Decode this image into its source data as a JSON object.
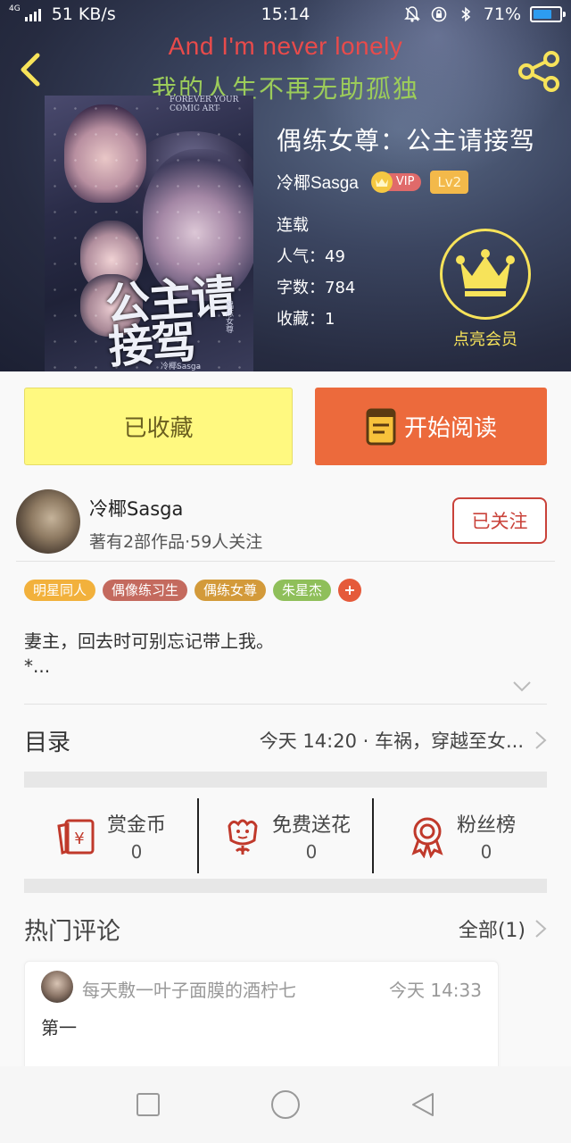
{
  "status_bar": {
    "network_tag": "4G",
    "speed": "51 KB/s",
    "time": "15:14",
    "battery": "71%",
    "battery_level": 0.71
  },
  "lyrics": {
    "line1": "And I'm never lonely",
    "line2": "我的人生不再无助孤独"
  },
  "cover": {
    "top_text": "FOREVER YOUR COMIC ART",
    "title": "公主请接驾",
    "credit": "偶练女尊",
    "author": "冷椰Sasga"
  },
  "book": {
    "title": "偶练女尊：公主请接驾",
    "author": "冷椰Sasga",
    "vip": "VIP",
    "level": "Lv2",
    "status": "连载",
    "popularity": "人气：49",
    "word_count": "字数：784",
    "favorites": "收藏：1"
  },
  "member": {
    "label": "点亮会员"
  },
  "actions": {
    "favorite": "已收藏",
    "read": "开始阅读"
  },
  "author": {
    "name": "冷椰Sasga",
    "summary": "著有2部作品·59人关注",
    "follow": "已关注"
  },
  "tags": [
    {
      "label": "明星同人",
      "color": "#f2b13c"
    },
    {
      "label": "偶像练习生",
      "color": "#c46a5e"
    },
    {
      "label": "偶练女尊",
      "color": "#d39a3a"
    },
    {
      "label": "朱星杰",
      "color": "#8fbf5a"
    }
  ],
  "description": {
    "line1": "妻主，回去时可别忘记带上我。",
    "line2": "*..."
  },
  "toc": {
    "title": "目录",
    "latest": "今天 14:20 · 车祸，穿越至女..."
  },
  "rewards": [
    {
      "label": "赏金币",
      "count": "0"
    },
    {
      "label": "免费送花",
      "count": "0"
    },
    {
      "label": "粉丝榜",
      "count": "0"
    }
  ],
  "comments": {
    "title": "热门评论",
    "all": "全部(1)",
    "items": [
      {
        "user": "每天敷一叶子面膜的酒柠七",
        "time": "今天 14:33",
        "text": "第一"
      }
    ]
  },
  "colors": {
    "accent_orange": "#ec6a3c",
    "favorite_yellow": "#fff980",
    "follow_red": "#c9423a",
    "member_gold": "#f7e35a",
    "reward_red": "#c0392b"
  }
}
